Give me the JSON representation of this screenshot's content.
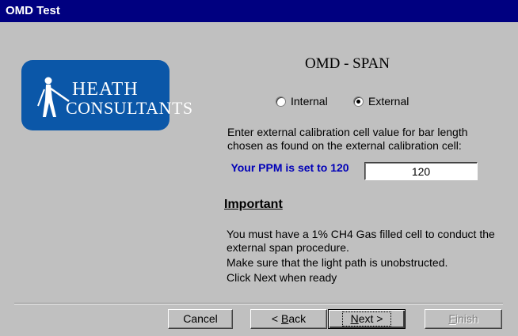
{
  "window": {
    "title": "OMD Test"
  },
  "logo": {
    "line1": "HEATH",
    "line2": "CONSULTANTS"
  },
  "heading": "OMD - SPAN",
  "mode": {
    "options": [
      {
        "label": "Internal",
        "selected": false
      },
      {
        "label": "External",
        "selected": true
      }
    ]
  },
  "description": "Enter external calibration cell value for bar length chosen as found on the external calibration cell:",
  "ppm": {
    "label": "Your PPM is set to 120",
    "value": "120"
  },
  "important": {
    "title": "Important",
    "lines": [
      "You must have a 1% CH4 Gas filled cell to conduct the external span procedure.",
      "Make sure that the light path is unobstructed.",
      "Click Next when ready"
    ]
  },
  "buttons": {
    "cancel": "Cancel",
    "back_prefix": "< ",
    "back_hotkey": "B",
    "back_rest": "ack",
    "next_hotkey": "N",
    "next_rest": "ext >",
    "finish_hotkey": "F",
    "finish_rest": "inish"
  },
  "colors": {
    "titlebar": "#000080",
    "logo_bg": "#0b57a8",
    "ppm_label": "#0000b8",
    "dialog_bg": "#c0c0c0"
  }
}
